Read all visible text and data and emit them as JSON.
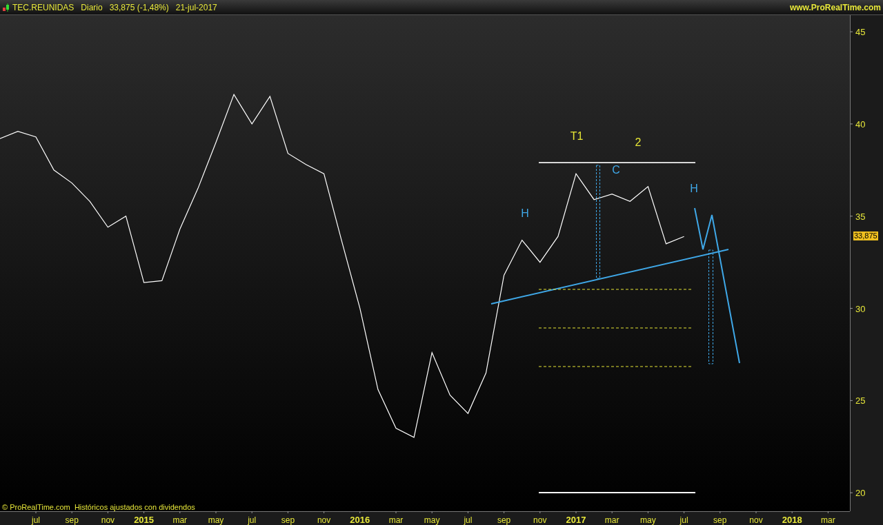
{
  "header": {
    "symbol": "TEC.REUNIDAS",
    "period": "Diario",
    "quote": "33,875 (-1,48%)",
    "date": "21-jul-2017",
    "site": "www.ProRealTime.com"
  },
  "chart": {
    "footer_note": "© ProRealTime.com  Históricos ajustados con dividendos",
    "last_price_label": "33,875",
    "pattern_labels": [
      {
        "text": "H",
        "color": "#3fa8e8"
      },
      {
        "text": "T1",
        "color": "#e5e535"
      },
      {
        "text": "2",
        "color": "#e5e535"
      },
      {
        "text": "C",
        "color": "#3fa8e8"
      },
      {
        "text": "H",
        "color": "#3fa8e8"
      }
    ],
    "chart_data": {
      "type": "line",
      "ylim": [
        19,
        45.9
      ],
      "yticks": [
        20,
        25,
        30,
        35,
        40,
        45
      ],
      "categories": [
        null,
        null,
        "jul",
        null,
        "sep",
        null,
        "nov",
        null,
        "2015",
        null,
        "mar",
        null,
        "may",
        null,
        "jul",
        null,
        "sep",
        null,
        "nov",
        null,
        "2016",
        null,
        "mar",
        null,
        "may",
        null,
        "jul",
        null,
        "sep",
        null,
        "nov",
        null,
        "2017",
        null,
        "mar",
        null,
        "may",
        null,
        "jul",
        null,
        "sep",
        null,
        "nov",
        null,
        "2018",
        null,
        "mar",
        null
      ],
      "series": [
        {
          "color": "#ffffff",
          "values": [
            39.2,
            39.6,
            39.3,
            37.5,
            36.8,
            35.8,
            34.4,
            35,
            31.4,
            31.5,
            34.3,
            36.5,
            39,
            41.6,
            40,
            41.5,
            38.4,
            37.8,
            37.3,
            33.6,
            30,
            25.6,
            23.5,
            23,
            27.6,
            25.3,
            24.3,
            26.5,
            31.8,
            33.7,
            32.5,
            33.9,
            37.3,
            35.9,
            36.2,
            35.8,
            36.6,
            33.5,
            33.9,
            null,
            null,
            null,
            null,
            null,
            null,
            null,
            null,
            null
          ]
        }
      ]
    }
  }
}
